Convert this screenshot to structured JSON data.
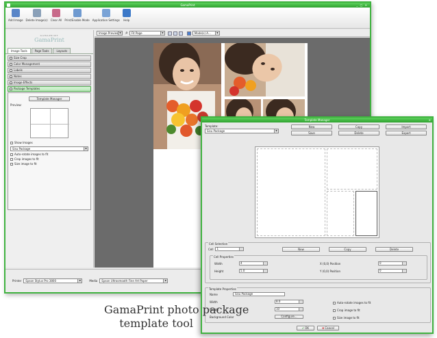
{
  "app": {
    "title": "GamaPrint"
  },
  "colors": {
    "accent": "#3fb23f",
    "canvas": "#6b6b6b"
  },
  "toolbar": {
    "buttons": [
      {
        "label": "Add Image",
        "icon": "add-image-icon",
        "color": "#5a86c8"
      },
      {
        "label": "Delete Image(s)",
        "icon": "delete-image-icon",
        "color": "#8aa0b8"
      },
      {
        "label": "Clear All",
        "icon": "clear-all-icon",
        "color": "#c86a8a"
      },
      {
        "label": "Print/Enable Mode",
        "icon": "print-mode-icon",
        "color": "#6f9ad0"
      },
      {
        "label": "Application Settings",
        "icon": "settings-icon",
        "color": "#7aa3d6"
      },
      {
        "label": "Help",
        "icon": "help-icon",
        "color": "#3b78c8"
      }
    ]
  },
  "left_pane": {
    "logo_small": "GAMAPRINT",
    "logo_large": "GamaPrint",
    "tabs": [
      "Image Tools",
      "Page Tools",
      "Layouts"
    ],
    "sections": [
      "Size Crop",
      "Color Management",
      "Labels",
      "Notes",
      "Image Effects",
      "Package Templates"
    ],
    "template_button": "Template Manager",
    "preview_label": "Preview:",
    "show_images": "Show Images",
    "package_select": "Sisu Package",
    "options": [
      "Auto-rotate images to fit",
      "Crop images to fit",
      "Size image to fit"
    ]
  },
  "viewbar": {
    "mode": "Image Preview",
    "zoom": "Fit Page",
    "filter": "Mode(s) A..."
  },
  "statusbar": {
    "printer_label": "Printer",
    "printer_value": "Epson Stylus Pro 3800",
    "media_label": "Media",
    "media_value": "Epson Ultrasmooth Fine Art Paper"
  },
  "dialog": {
    "title": "Template Manager",
    "template_label": "Template:",
    "template_value": "Sisu Package",
    "buttons": [
      "New",
      "Copy",
      "Import",
      "Save",
      "Delete",
      "Export"
    ],
    "cell_selection": {
      "group": "Cell Selection",
      "cell_label": "Cell",
      "cell_value": "1",
      "buttons": [
        "New",
        "Copy",
        "Delete"
      ]
    },
    "cell_properties": {
      "group": "Cell Properties",
      "width_label": "Width",
      "width_value": "4",
      "height_label": "Height",
      "height_value": "5.0",
      "x_label": "X (0,0) Position",
      "x_value": "0",
      "y_label": "Y (0,0) Position",
      "y_value": "0"
    },
    "template_properties": {
      "group": "Template Properties",
      "name_label": "Name",
      "name_value": "Sisu Package",
      "width_label": "Width",
      "width_value": "8.0",
      "height_label": "Height",
      "height_value": "10",
      "background_label": "Background Color",
      "background_button": "Configure...",
      "options": [
        "Auto-rotate images to fit",
        "Crop image to fit",
        "Size image to fit"
      ]
    },
    "ok": "OK",
    "cancel": "Cancel"
  },
  "caption": {
    "line1": "GamaPrint photo package",
    "line2": "template tool"
  }
}
